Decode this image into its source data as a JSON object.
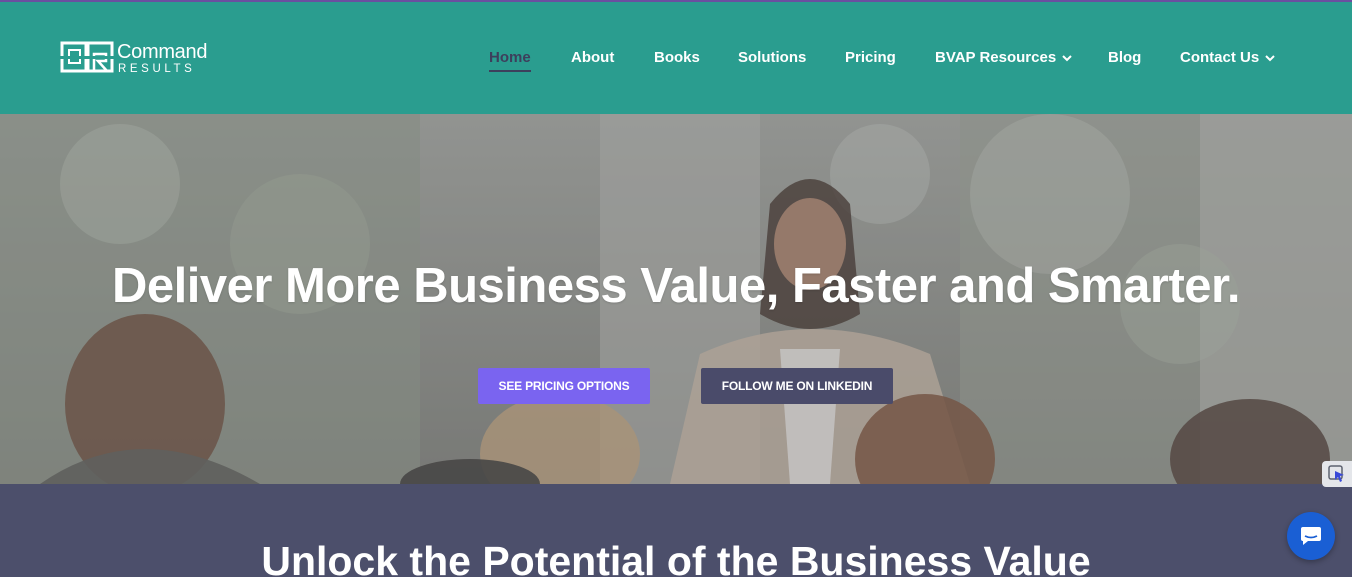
{
  "brand": {
    "name_line1": "Command",
    "name_line2": "RESULTS",
    "logo_icon": "cr-monogram-icon"
  },
  "nav": {
    "items": [
      {
        "label": "Home",
        "active": true
      },
      {
        "label": "About"
      },
      {
        "label": "Books"
      },
      {
        "label": "Solutions"
      },
      {
        "label": "Pricing"
      },
      {
        "label": "BVAP Resources",
        "dropdown": true
      },
      {
        "label": "Blog"
      },
      {
        "label": "Contact Us",
        "dropdown": true
      }
    ]
  },
  "hero": {
    "title": "Deliver More Business Value, Faster and Smarter.",
    "buttons": {
      "pricing": "SEE PRICING OPTIONS",
      "linkedin": "FOLLOW ME ON LINKEDIN"
    }
  },
  "section": {
    "title": "Unlock the Potential of the Business Value"
  },
  "widgets": {
    "side": "cursor-arrow-icon",
    "chat": "chat-bubble-icon"
  },
  "colors": {
    "header": "#2a9d8f",
    "accent_button": "#7a64f0",
    "dark_button": "#4a4b6a",
    "section_bg": "#4c4f6b",
    "chat_button": "#1a5fd4",
    "active_nav": "#3d3f5c"
  }
}
